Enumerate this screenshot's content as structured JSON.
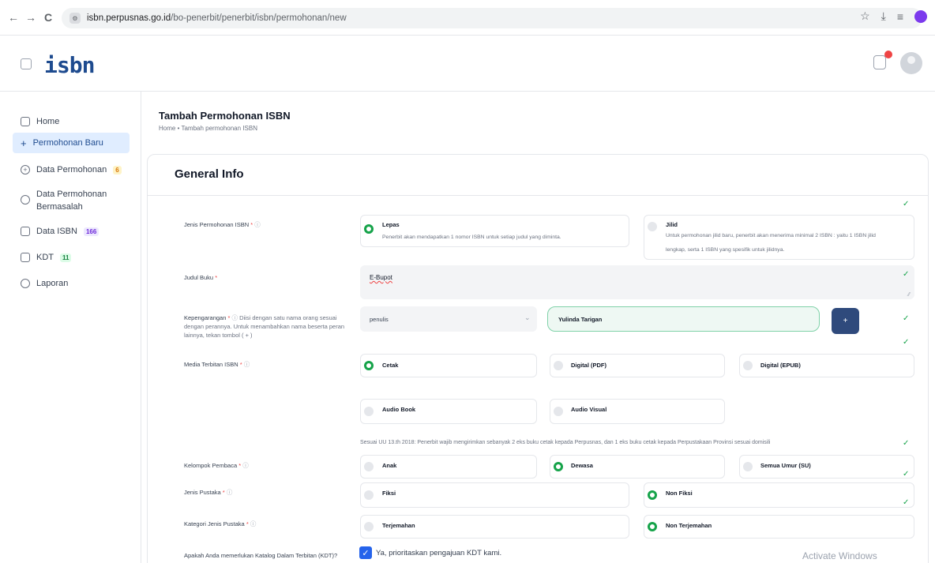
{
  "browser": {
    "url_host": "isbn.perpusnas.go.id",
    "url_path": "/bo-penerbit/penerbit/isbn/permohonan/new",
    "back_glyph": "←",
    "forward_glyph": "→",
    "reload_glyph": "C"
  },
  "app": {
    "logo": "isbn"
  },
  "sidebar": {
    "items": [
      {
        "label": "Home",
        "icon": "grid-icon",
        "badge": ""
      },
      {
        "label": "Permohonan Baru",
        "icon": "plus-icon",
        "badge": ""
      },
      {
        "label": "Data Permohonan",
        "icon": "plus-circle-icon",
        "badge": "6"
      },
      {
        "label": "Data Permohonan",
        "label2": "Bermasalah",
        "icon": "folder-icon",
        "badge": ""
      },
      {
        "label": "Data ISBN",
        "icon": "barcode-icon",
        "badge": "166"
      },
      {
        "label": "KDT",
        "icon": "document-icon",
        "badge": "11"
      },
      {
        "label": "Laporan",
        "icon": "chart-icon",
        "badge": ""
      }
    ]
  },
  "page": {
    "title": "Tambah Permohonan ISBN",
    "breadcrumb_home": "Home",
    "breadcrumb_sep": "•",
    "breadcrumb_current": "Tambah permohonan ISBN"
  },
  "card": {
    "title": "General Info"
  },
  "form": {
    "jenis_permohonan": {
      "label": "Jenis Permohonan ISBN",
      "options": [
        {
          "title": "Lepas",
          "desc": "Penerbit akan mendapatkan 1 nomor ISBN untuk setiap judul yang diminta.",
          "selected": true
        },
        {
          "title": "Jilid",
          "desc1": "Untuk permohonan jilid baru, penerbit akan menerima minimal 2 ISBN : yaitu 1 ISBN jilid",
          "desc2": "lengkap, serta 1 ISBN yang spesifik untuk jilidnya.",
          "selected": false
        }
      ]
    },
    "judul_buku": {
      "label": "Judul Buku",
      "value": "E-Bupot"
    },
    "kepengarangan": {
      "label": "Kepengarangan",
      "hint1": "Diisi dengan satu nama orang sesuai dengan",
      "hint2": "perannya. Untuk menambahkan nama beserta peran lainnya, tekan",
      "hint3": "tombol ( + )",
      "role_value": "penulis",
      "name_value": "Yulinda Tarigan",
      "add_label": "+"
    },
    "media_terbitan": {
      "label": "Media Terbitan ISBN",
      "options": [
        {
          "title": "Cetak",
          "selected": true
        },
        {
          "title": "Digital (PDF)",
          "selected": false
        },
        {
          "title": "Digital (EPUB)",
          "selected": false
        },
        {
          "title": "Audio Book",
          "selected": false
        },
        {
          "title": "Audio Visual",
          "selected": false
        }
      ],
      "notice": "Sesuai UU 13.th 2018: Penerbit wajib mengirimkan sebanyak 2 eks buku cetak kepada Perpusnas, dan 1 eks buku cetak kepada Perpustakaan Provinsi sesuai domisili"
    },
    "kelompok_pembaca": {
      "label": "Kelompok Pembaca",
      "options": [
        {
          "title": "Anak",
          "selected": false
        },
        {
          "title": "Dewasa",
          "selected": true
        },
        {
          "title": "Semua Umur (SU)",
          "selected": false
        }
      ]
    },
    "jenis_pustaka": {
      "label": "Jenis Pustaka",
      "options": [
        {
          "title": "Fiksi",
          "selected": false
        },
        {
          "title": "Non Fiksi",
          "selected": true
        }
      ]
    },
    "kategori_jenis_pustaka": {
      "label": "Kategori Jenis Pustaka",
      "options": [
        {
          "title": "Terjemahan",
          "selected": false
        },
        {
          "title": "Non Terjemahan",
          "selected": true
        }
      ]
    },
    "kdt": {
      "label": "Apakah Anda memerlukan Katalog Dalam Terbitan (KDT)?",
      "checkbox_label": "Ya, prioritaskan pengajuan KDT kami.",
      "checked": true
    }
  },
  "watermark": "Activate Windows",
  "colors": {
    "accent": "#1e4b8f",
    "radio_selected": "#16a34a",
    "check": "#16a34a",
    "plus_button": "#2f4a7c"
  }
}
